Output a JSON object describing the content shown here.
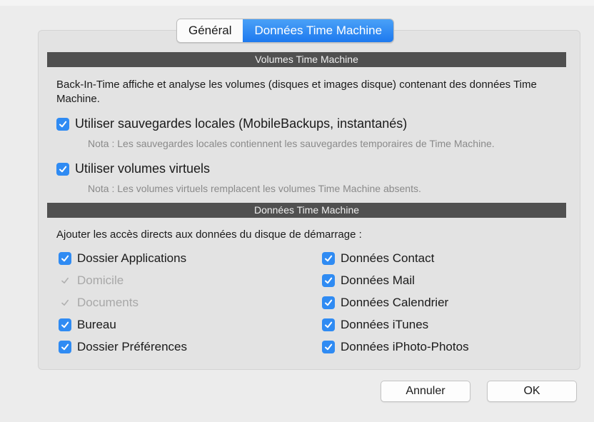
{
  "tabs": [
    {
      "label": "Général"
    },
    {
      "label": "Données Time Machine"
    }
  ],
  "volumes": {
    "header": "Volumes Time Machine",
    "description": "Back-In-Time affiche et analyse les volumes (disques et images disque) contenant des données Time Machine.",
    "local_backups": {
      "label": "Utiliser sauvegardes locales (MobileBackups, instantanés)",
      "checked": true,
      "note": "Nota : Les sauvegardes locales contiennent les sauvegardes temporaires de Time Machine."
    },
    "virtual_volumes": {
      "label": "Utiliser volumes virtuels",
      "checked": true,
      "note": "Nota : Les volumes virtuels remplacent les volumes Time Machine absents."
    }
  },
  "data": {
    "header": "Données Time Machine",
    "intro": "Ajouter les accès directs aux données du disque de démarrage :",
    "left": [
      {
        "label": "Dossier Applications",
        "checked": true,
        "enabled": true
      },
      {
        "label": "Domicile",
        "checked": true,
        "enabled": false
      },
      {
        "label": "Documents",
        "checked": true,
        "enabled": false
      },
      {
        "label": "Bureau",
        "checked": true,
        "enabled": true
      },
      {
        "label": "Dossier Préférences",
        "checked": true,
        "enabled": true
      }
    ],
    "right": [
      {
        "label": "Données Contact",
        "checked": true,
        "enabled": true
      },
      {
        "label": "Données Mail",
        "checked": true,
        "enabled": true
      },
      {
        "label": "Données Calendrier",
        "checked": true,
        "enabled": true
      },
      {
        "label": "Données iTunes",
        "checked": true,
        "enabled": true
      },
      {
        "label": "Données iPhoto-Photos",
        "checked": true,
        "enabled": true
      }
    ]
  },
  "buttons": {
    "cancel": "Annuler",
    "ok": "OK"
  },
  "colors": {
    "accent": "#2f8bf3",
    "header_bg": "#505050",
    "disabled_text": "#a8a8a8"
  },
  "icons": {
    "checkbox": "checkmark-icon"
  }
}
